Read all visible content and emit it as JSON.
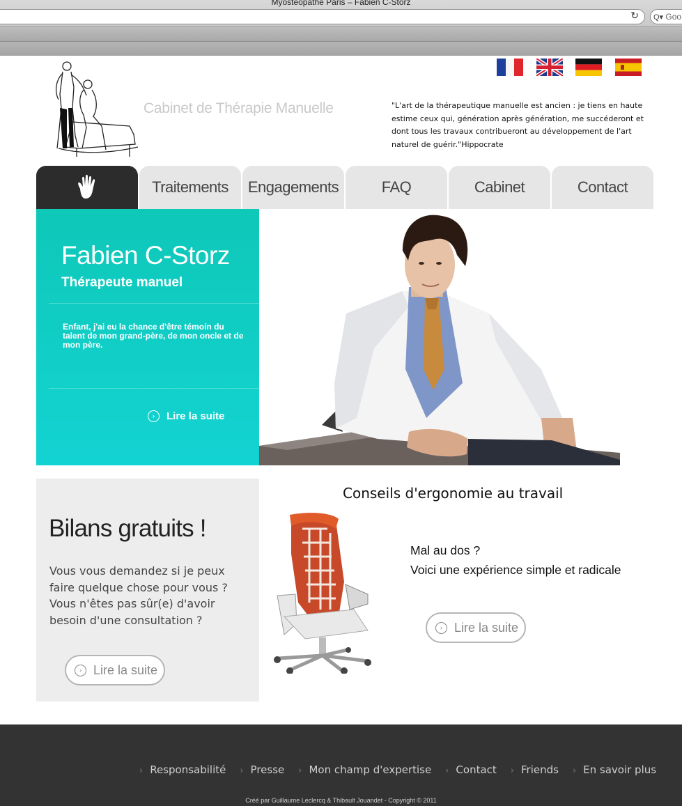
{
  "browser": {
    "window_title": "Myostéopathe Paris – Fabien C-Storz",
    "search_placeholder": "Goo"
  },
  "header": {
    "site_title": "Cabinet de Thérapie Manuelle",
    "quote": "\"L'art de la thérapeutique manuelle est ancien : je tiens en haute estime ceux qui, génération après génération, me succéderont et dont tous les travaux contribueront au développement de l'art naturel de guérir.\"Hippocrate",
    "flags": [
      "flag-france-icon",
      "flag-uk-icon",
      "flag-germany-icon",
      "flag-spain-icon"
    ]
  },
  "nav": {
    "home_icon": "hand-icon",
    "tabs": [
      "Traitements",
      "Engagements",
      "FAQ",
      "Cabinet",
      "Contact"
    ]
  },
  "hero": {
    "name": "Fabien C-Storz",
    "role": "Thérapeute manuel",
    "text": "Enfant, j'ai eu la chance d'être témoin du talent de mon grand-père, de mon oncle et de mon père.",
    "read_more": "Lire la suite",
    "color": "#13d3d2"
  },
  "bilans": {
    "title": "Bilans gratuits !",
    "text": "Vous vous demandez si je peux faire quelque chose pour vous ? Vous n'êtes pas sûr(e) d'avoir besoin d'une consultation ?",
    "read_more": "Lire la suite"
  },
  "ergonomie": {
    "title": "Conseils d'ergonomie au travail",
    "line1": "Mal au dos ?",
    "line2": "Voici une expérience simple et radicale",
    "read_more": "Lire la suite"
  },
  "footer": {
    "links": [
      "Responsabilité",
      "Presse",
      "Mon champ d'expertise",
      "Contact",
      "Friends",
      "En savoir plus"
    ],
    "credit": "Créé par Guillaume Leclercq & Thibault Jouandet - Copyright © 2011"
  }
}
